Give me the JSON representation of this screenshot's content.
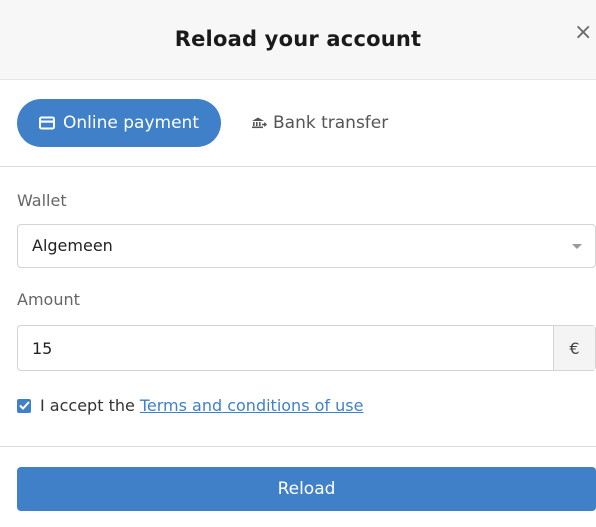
{
  "modal": {
    "title": "Reload your account",
    "close_glyph": "×"
  },
  "tabs": [
    {
      "label": "Online payment",
      "icon": "credit-card-icon",
      "active": true
    },
    {
      "label": "Bank transfer",
      "icon": "bank-transfer-icon",
      "active": false
    }
  ],
  "wallet": {
    "label": "Wallet",
    "selected": "Algemeen"
  },
  "amount": {
    "label": "Amount",
    "value": "15",
    "currency": "€"
  },
  "terms": {
    "checked": true,
    "prefix": "I accept the",
    "link_text": "Terms and conditions of use"
  },
  "submit": {
    "label": "Reload"
  },
  "colors": {
    "accent": "#3f80c8",
    "header_bg": "#f7f7f7",
    "divider": "#dcdcdc"
  }
}
